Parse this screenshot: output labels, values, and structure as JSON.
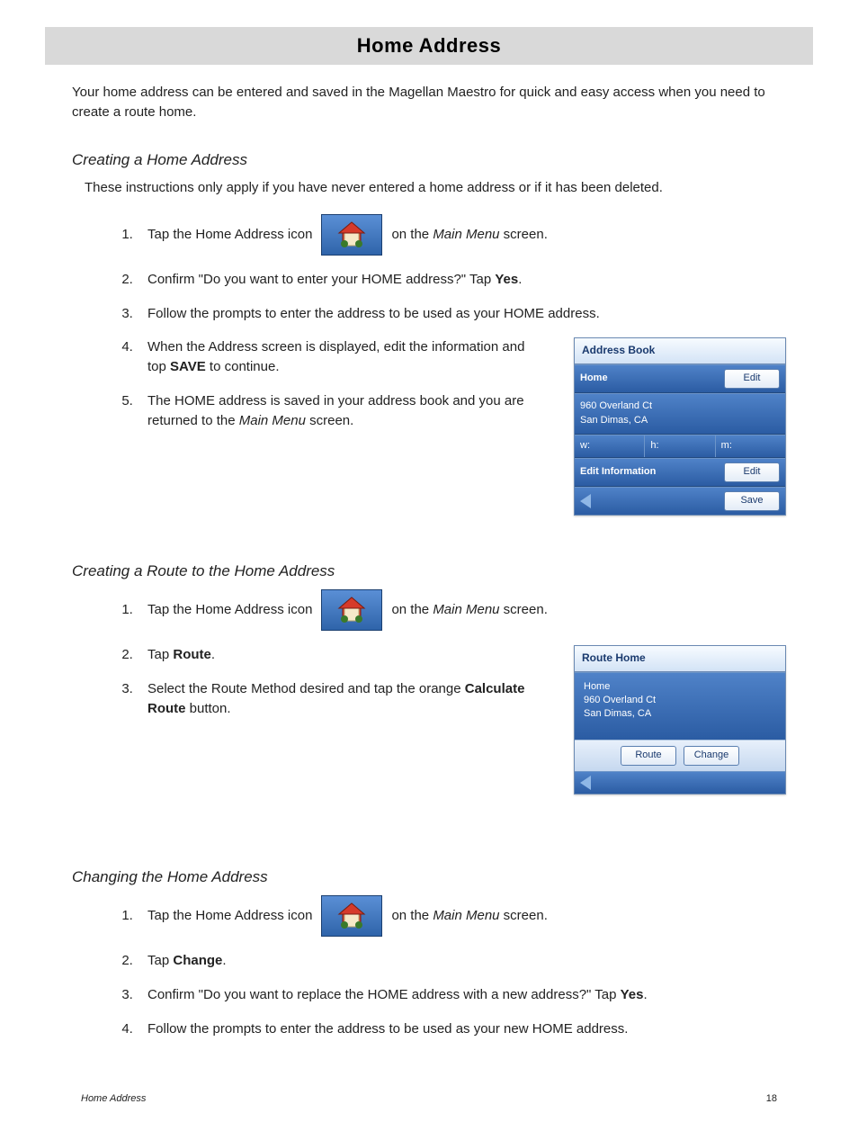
{
  "title": "Home Address",
  "intro": "Your home address can be entered and saved in the Magellan Maestro for quick and easy access when you need to create a route home.",
  "sectionA": {
    "heading": "Creating a Home Address",
    "sub": "These instructions only apply if you have never entered a home address or if it has been deleted.",
    "step1a": "Tap the Home Address icon",
    "step1b_a": "on the ",
    "step1b_i": "Main Menu",
    "step1b_c": " screen.",
    "step2_a": "Confirm \"Do you want to enter your HOME address?\"  Tap ",
    "step2_b": "Yes",
    "step2_c": ".",
    "step3": "Follow the prompts to enter the address to be used as your HOME address.",
    "step4_a": "When the Address screen is displayed, edit the information and top ",
    "step4_b": "SAVE",
    "step4_c": " to continue.",
    "step5_a": "The HOME address is saved in your address book and you are returned to the ",
    "step5_i": "Main Menu",
    "step5_c": " screen."
  },
  "addressBook": {
    "title": "Address Book",
    "home": "Home",
    "edit": "Edit",
    "line1": "960 Overland Ct",
    "line2": "San Dimas, CA",
    "w": "w:",
    "h": "h:",
    "m": "m:",
    "editInfo": "Edit Information",
    "save": "Save"
  },
  "sectionB": {
    "heading": "Creating a Route to the Home Address",
    "step1a": "Tap the Home Address icon",
    "step1b_a": "on the ",
    "step1b_i": "Main Menu",
    "step1b_c": " screen.",
    "step2_a": "Tap ",
    "step2_b": "Route",
    "step2_c": ".",
    "step3_a": "Select the Route Method desired and tap the orange ",
    "step3_b": "Calculate Route",
    "step3_c": " button."
  },
  "routeHome": {
    "title": "Route Home",
    "home": "Home",
    "line1": "960 Overland Ct",
    "line2": "San Dimas, CA",
    "route": "Route",
    "change": "Change"
  },
  "sectionC": {
    "heading": "Changing the Home Address",
    "step1a": "Tap the Home Address icon",
    "step1b_a": "on the ",
    "step1b_i": "Main Menu",
    "step1b_c": " screen.",
    "step2_a": "Tap ",
    "step2_b": "Change",
    "step2_c": ".",
    "step3_a": "Confirm \"Do you want to replace the HOME address with a new address?\"  Tap ",
    "step3_b": "Yes",
    "step3_c": ".",
    "step4": "Follow the prompts to enter the address to be used as your new HOME address."
  },
  "footer": {
    "left": "Home Address",
    "right": "18"
  }
}
